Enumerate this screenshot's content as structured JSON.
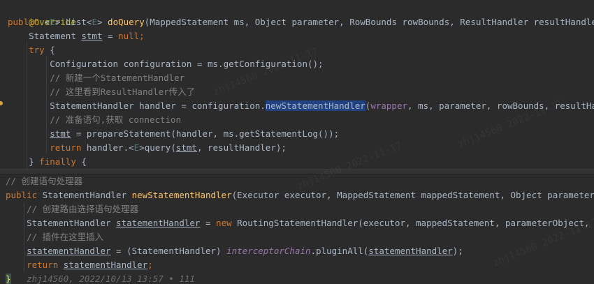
{
  "top_pane": {
    "lines": [
      {
        "indent": "",
        "annotation": "@Override"
      },
      {
        "indent": "",
        "kw_public": "public",
        "generic_open": " <",
        "generic_E": "E",
        "generic_close": "> ",
        "list": "List<",
        "list_E": "E",
        "list_close": "> ",
        "method": "doQuery",
        "params": "(MappedStatement ms, Object parameter, RowBounds rowBounds, ResultHandler resultHandler, BoundSql"
      },
      {
        "indent": "    ",
        "type": "Statement ",
        "var": "stmt",
        "eq": " = ",
        "null": "null",
        "semi": ";"
      },
      {
        "indent": "    ",
        "kw": "try",
        "rest": " {"
      },
      {
        "indent": "        ",
        "code": "Configuration configuration = ms.getConfiguration();"
      },
      {
        "indent": "        ",
        "comment": "// 新建一个StatementHandler"
      },
      {
        "indent": "        ",
        "comment": "// 这里看到ResultHandler传入了"
      },
      {
        "indent": "        ",
        "pre": "StatementHandler handler = configuration.",
        "selected": "newStatementHandler",
        "paren": "(",
        "wrapper": "wrapper",
        "post": ", ms, parameter, rowBounds, resultHandler, bo"
      },
      {
        "indent": "        ",
        "comment": "// 准备语句,获取 connection"
      },
      {
        "indent": "        ",
        "var": "stmt",
        "rest": " = prepareStatement(handler, ms.getStatementLog());"
      },
      {
        "indent": "        ",
        "kw": "return",
        "pre": " handler.<",
        "typeE": "E",
        "mid": ">query(",
        "var": "stmt",
        "post": ", resultHandler);"
      },
      {
        "indent": "    ",
        "pre": "} ",
        "kw": "finally",
        "post": " {"
      }
    ]
  },
  "bottom_pane": {
    "lines": [
      {
        "comment": "// 创建语句处理器"
      },
      {
        "kw": "public",
        "pre": " StatementHandler ",
        "method": "newStatementHandler",
        "post": "(Executor executor, MappedStatement mappedStatement, Object parameterObject, Ro"
      },
      {
        "indent": "    ",
        "comment": "// 创建路由选择语句处理器"
      },
      {
        "indent": "    ",
        "pre": "StatementHandler ",
        "var": "statementHandler",
        "eq": " = ",
        "kw": "new",
        "post": " RoutingStatementHandler(executor, mappedStatement, parameterObject, rowBounds"
      },
      {
        "indent": "    ",
        "comment": "// 插件在这里插入"
      },
      {
        "indent": "    ",
        "var": "statementHandler",
        "pre": " = (StatementHandler) ",
        "field": "interceptorChain",
        "post": ".pluginAll(",
        "var2": "statementHandler",
        "end": ");"
      },
      {
        "indent": "    ",
        "kw": "return",
        "pre": " ",
        "var": "statementHandler",
        "semi": ";"
      },
      {
        "brace": "}",
        "blame": "   zhj14560, 2022/10/13 13:57 • 111"
      }
    ]
  },
  "watermark_text": "zhj14560  2022-11-17",
  "colors": {
    "background": "#2b2b2b",
    "keyword": "#cc7832",
    "method_declaration": "#ffc66d",
    "comment": "#808080",
    "annotation": "#bbb529",
    "field": "#9876aa",
    "selection": "#214283"
  }
}
